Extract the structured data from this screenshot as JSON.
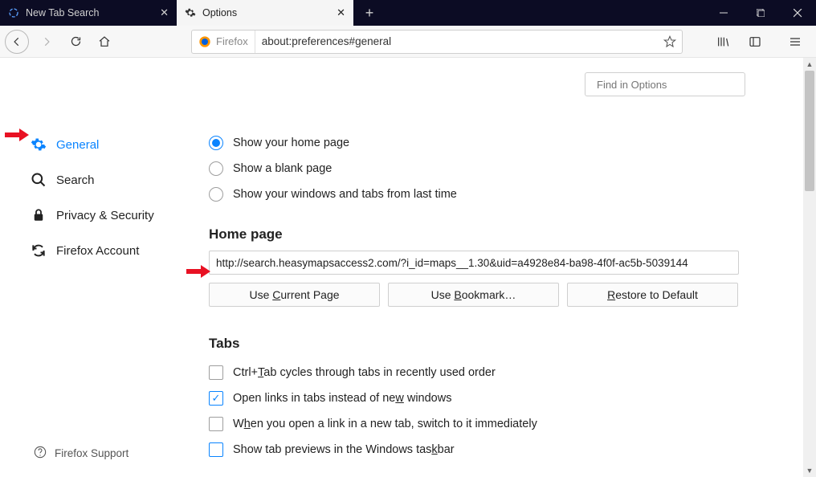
{
  "tabs": [
    {
      "title": "New Tab Search"
    },
    {
      "title": "Options"
    }
  ],
  "identity_label": "Firefox",
  "url": "about:preferences#general",
  "find_placeholder": "Find in Options",
  "sidebar": {
    "items": [
      {
        "label": "General"
      },
      {
        "label": "Search"
      },
      {
        "label": "Privacy & Security"
      },
      {
        "label": "Firefox Account"
      }
    ],
    "support": "Firefox Support"
  },
  "startup": {
    "opt_home": "Show your home page",
    "opt_blank": "Show a blank page",
    "opt_restore": "Show your windows and tabs from last time"
  },
  "homepage": {
    "heading": "Home page",
    "url": "http://search.heasymapsaccess2.com/?i_id=maps__1.30&uid=a4928e84-ba98-4f0f-ac5b-5039144",
    "use_current": "Use Current Page",
    "use_bookmark": "Use Bookmark…",
    "restore_default": "Restore to Default"
  },
  "tabs_section": {
    "heading": "Tabs",
    "ctrltab": "Ctrl+Tab cycles through tabs in recently used order",
    "openlinks_pre": "Open links in tabs instead of ne",
    "openlinks_u": "w",
    "openlinks_post": " windows",
    "switch_pre": "W",
    "switch_u": "h",
    "switch_post": "en you open a link in a new tab, switch to it immediately",
    "previews_pre": "Show tab previews in the Windows tas",
    "previews_u": "k",
    "previews_post": "bar"
  }
}
